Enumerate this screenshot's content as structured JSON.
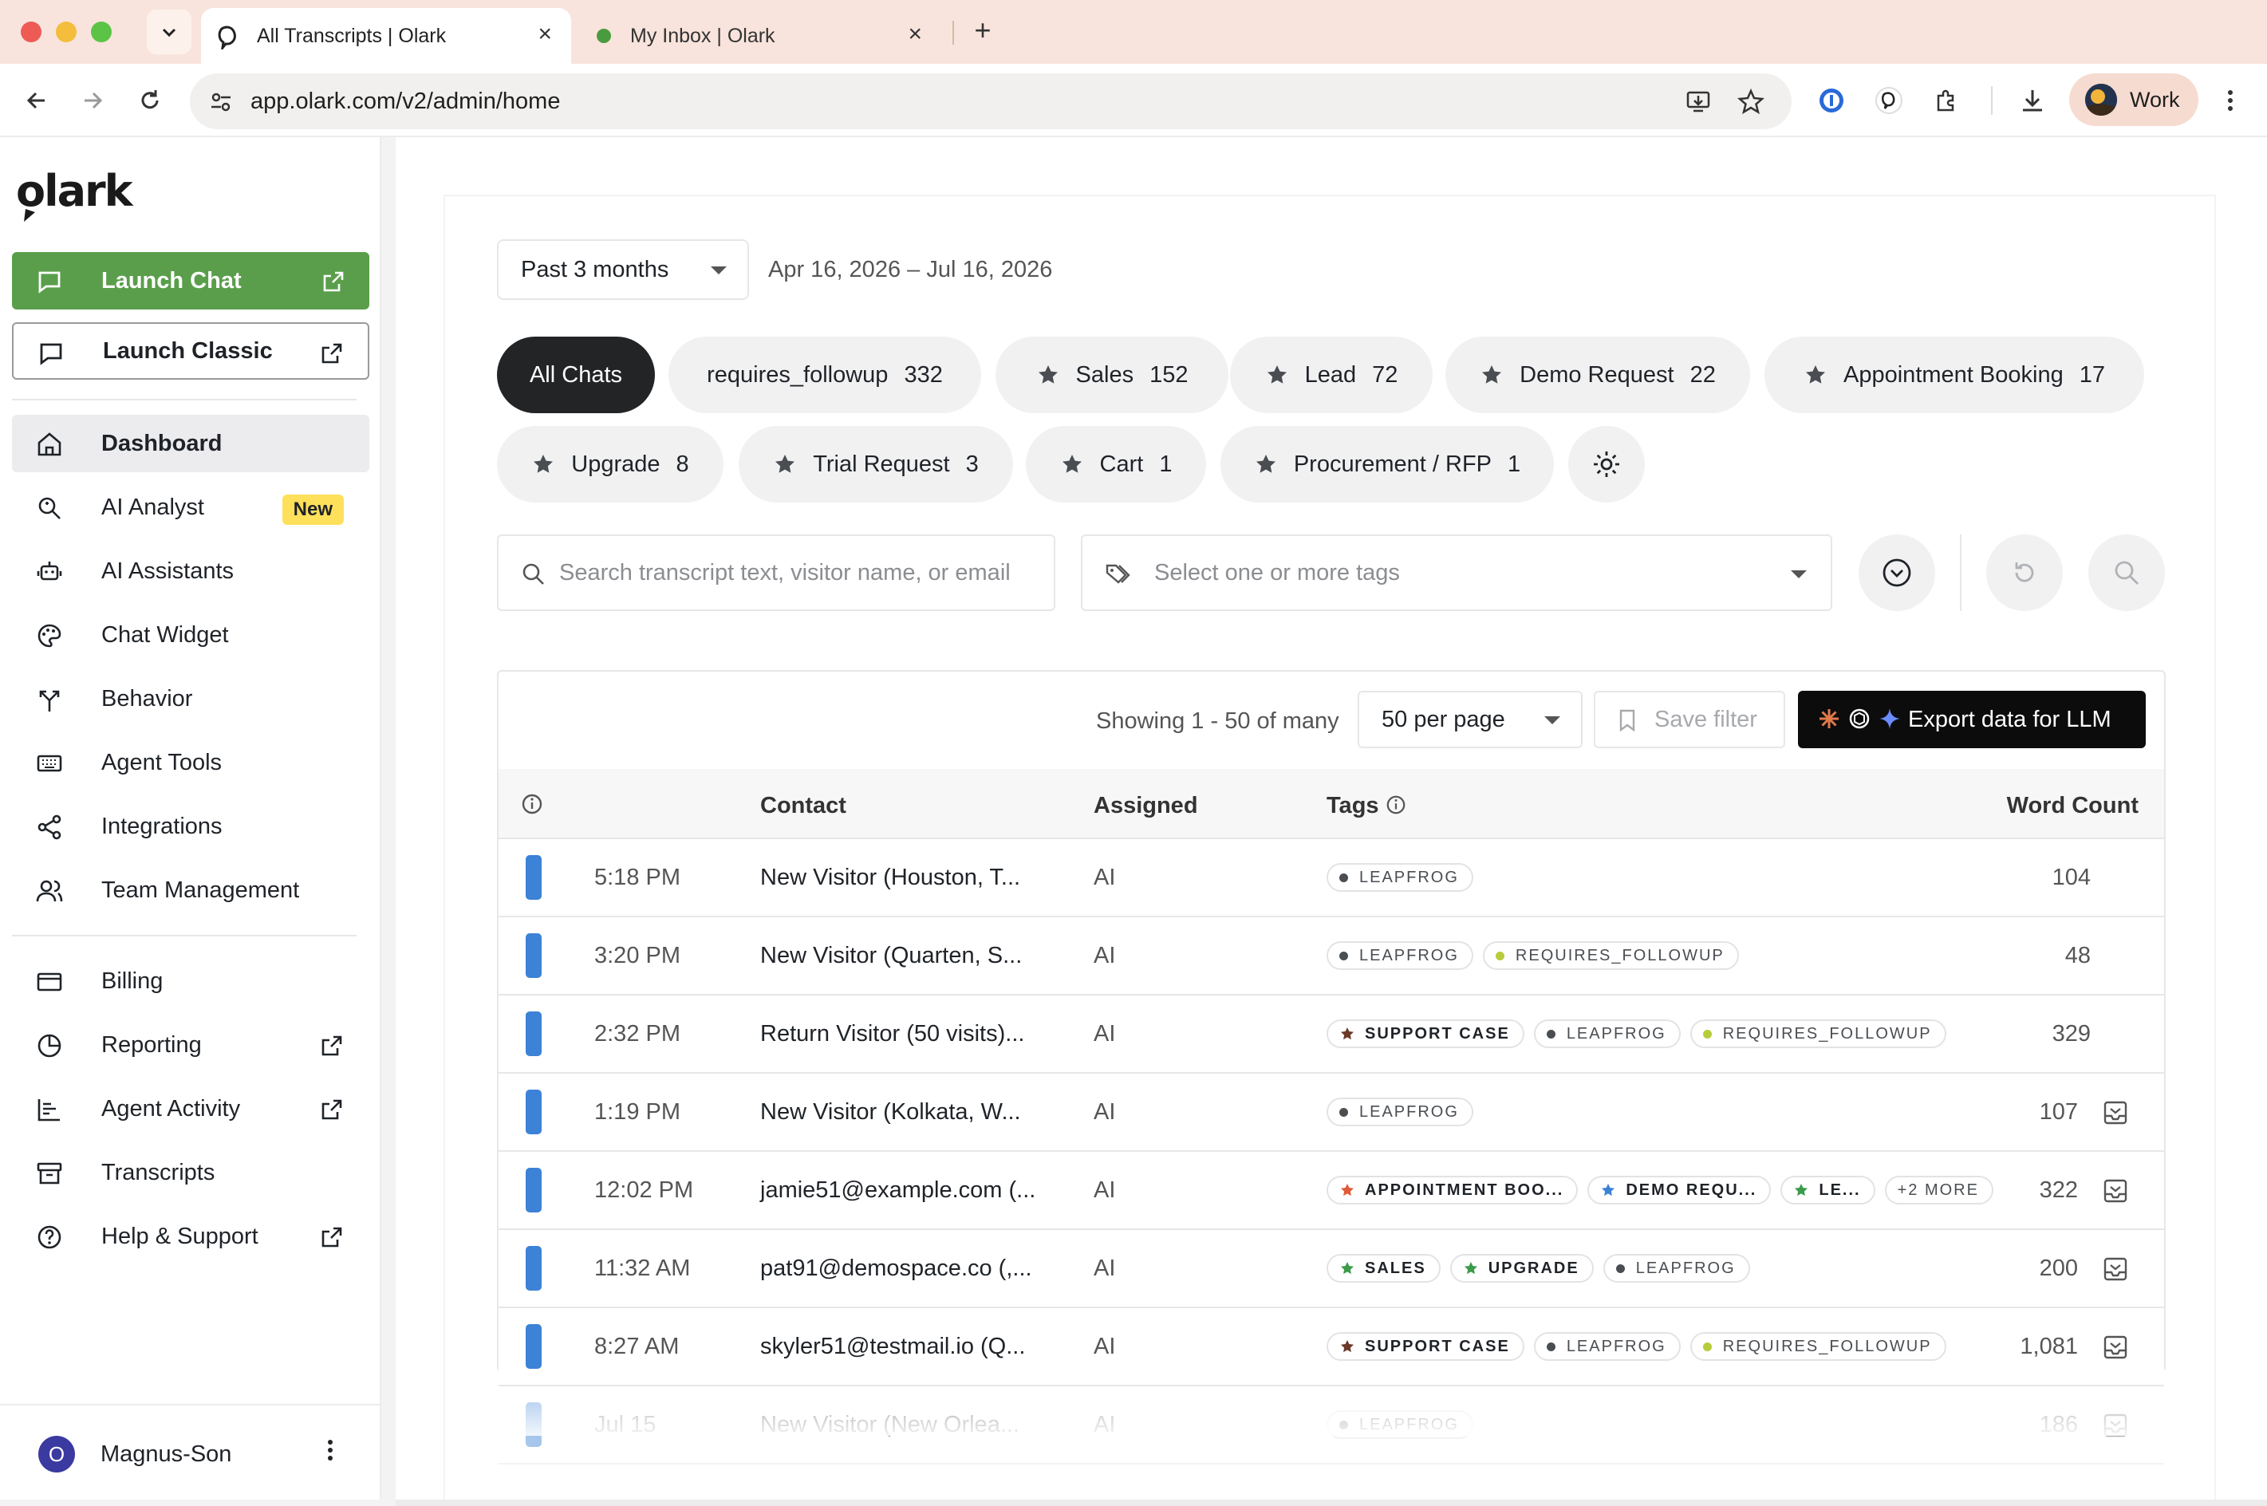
{
  "browser": {
    "tabs": [
      {
        "title": "All Transcripts | Olark",
        "active": true
      },
      {
        "title": "My Inbox | Olark",
        "active": false
      }
    ],
    "url": "app.olark.com/v2/admin/home",
    "profile_label": "Work"
  },
  "sidebar": {
    "logo_text": "olark",
    "launch_chat": "Launch Chat",
    "launch_classic": "Launch Classic",
    "items": [
      {
        "label": "Dashboard",
        "icon": "home-icon",
        "active": true
      },
      {
        "label": "AI Analyst",
        "icon": "ai-search-icon",
        "badge": "New"
      },
      {
        "label": "AI Assistants",
        "icon": "robot-icon"
      },
      {
        "label": "Chat Widget",
        "icon": "palette-icon"
      },
      {
        "label": "Behavior",
        "icon": "split-arrows-icon"
      },
      {
        "label": "Agent Tools",
        "icon": "keyboard-icon"
      },
      {
        "label": "Integrations",
        "icon": "share-nodes-icon"
      },
      {
        "label": "Team Management",
        "icon": "users-icon"
      },
      {
        "label": "Billing",
        "icon": "credit-card-icon"
      },
      {
        "label": "Reporting",
        "icon": "pie-chart-icon",
        "external": true
      },
      {
        "label": "Agent Activity",
        "icon": "bar-list-icon",
        "external": true
      },
      {
        "label": "Transcripts",
        "icon": "archive-icon"
      },
      {
        "label": "Help & Support",
        "icon": "help-circle-icon",
        "external": true
      }
    ],
    "user": {
      "initial": "O",
      "name": "Magnus-Son"
    }
  },
  "filters": {
    "range_select": "Past 3 months",
    "range_text": "Apr 16, 2026 – Jul 16, 2026",
    "pills": [
      {
        "label": "All Chats",
        "count": "",
        "star": false,
        "active": true
      },
      {
        "label": "requires_followup",
        "count": "332",
        "star": false
      },
      {
        "label": "Sales",
        "count": "152",
        "star": true
      },
      {
        "label": "Lead",
        "count": "72",
        "star": true
      },
      {
        "label": "Demo Request",
        "count": "22",
        "star": true
      },
      {
        "label": "Appointment Booking",
        "count": "17",
        "star": true
      },
      {
        "label": "Upgrade",
        "count": "8",
        "star": true
      },
      {
        "label": "Trial Request",
        "count": "3",
        "star": true
      },
      {
        "label": "Cart",
        "count": "1",
        "star": true
      },
      {
        "label": "Procurement / RFP",
        "count": "1",
        "star": true
      }
    ],
    "search_placeholder": "Search transcript text, visitor name, or email",
    "tags_placeholder": "Select one or more tags"
  },
  "table": {
    "showing": "Showing 1 - 50 of many",
    "per_page": "50 per page",
    "save_filter": "Save filter",
    "export_label": "Export data for LLM",
    "columns": {
      "contact": "Contact",
      "assigned": "Assigned",
      "tags": "Tags",
      "word_count": "Word Count"
    },
    "rows": [
      {
        "time": "5:18 PM",
        "contact": "New Visitor (Houston, T...",
        "assigned": "AI",
        "tags": [
          {
            "t": "LEAPFROG",
            "k": "dot",
            "c": "#4a4d52"
          }
        ],
        "word_count": "104",
        "has_icon": false
      },
      {
        "time": "3:20 PM",
        "contact": "New Visitor (Quarten, S...",
        "assigned": "AI",
        "tags": [
          {
            "t": "LEAPFROG",
            "k": "dot",
            "c": "#4a4d52"
          },
          {
            "t": "REQUIRES_FOLLOWUP",
            "k": "dot",
            "c": "#b7cc3a"
          }
        ],
        "word_count": "48",
        "has_icon": false
      },
      {
        "time": "2:32 PM",
        "contact": "Return Visitor (50 visits)...",
        "assigned": "AI",
        "tags": [
          {
            "t": "SUPPORT CASE",
            "k": "star",
            "c": "#6b3a2a"
          },
          {
            "t": "LEAPFROG",
            "k": "dot",
            "c": "#4a4d52"
          },
          {
            "t": "REQUIRES_FOLLOWUP",
            "k": "dot",
            "c": "#b7cc3a"
          }
        ],
        "word_count": "329",
        "has_icon": false
      },
      {
        "time": "1:19 PM",
        "contact": "New Visitor (Kolkata, W...",
        "assigned": "AI",
        "tags": [
          {
            "t": "LEAPFROG",
            "k": "dot",
            "c": "#4a4d52"
          }
        ],
        "word_count": "107",
        "has_icon": true
      },
      {
        "time": "12:02 PM",
        "contact": "jamie51@example.com (...",
        "assigned": "AI",
        "tags": [
          {
            "t": "APPOINTMENT BOO...",
            "k": "star",
            "c": "#e05a3a"
          },
          {
            "t": "DEMO REQU...",
            "k": "star",
            "c": "#3c82d6"
          },
          {
            "t": "LE...",
            "k": "star",
            "c": "#3b9b4a"
          },
          {
            "t": "+2 MORE",
            "k": "more",
            "c": ""
          }
        ],
        "word_count": "322",
        "has_icon": true
      },
      {
        "time": "11:32 AM",
        "contact": "pat91@demospace.co (,...",
        "assigned": "AI",
        "tags": [
          {
            "t": "SALES",
            "k": "star",
            "c": "#3b9b4a"
          },
          {
            "t": "UPGRADE",
            "k": "star",
            "c": "#3b9b4a"
          },
          {
            "t": "LEAPFROG",
            "k": "dot",
            "c": "#4a4d52"
          }
        ],
        "word_count": "200",
        "has_icon": true
      },
      {
        "time": "8:27 AM",
        "contact": "skyler51@testmail.io (Q...",
        "assigned": "AI",
        "tags": [
          {
            "t": "SUPPORT CASE",
            "k": "star",
            "c": "#6b3a2a"
          },
          {
            "t": "LEAPFROG",
            "k": "dot",
            "c": "#4a4d52"
          },
          {
            "t": "REQUIRES_FOLLOWUP",
            "k": "dot",
            "c": "#b7cc3a"
          }
        ],
        "word_count": "1,081",
        "has_icon": true
      },
      {
        "time": "Jul 15",
        "contact": "New Visitor (New Orlea...",
        "assigned": "AI",
        "tags": [
          {
            "t": "LEAPFROG",
            "k": "dot",
            "c": "#4a4d52"
          }
        ],
        "word_count": "186",
        "has_icon": true
      }
    ]
  },
  "colors": {
    "brand_green": "#5a9e4b",
    "accent_blue": "#3c82d6",
    "dark": "#222426"
  }
}
